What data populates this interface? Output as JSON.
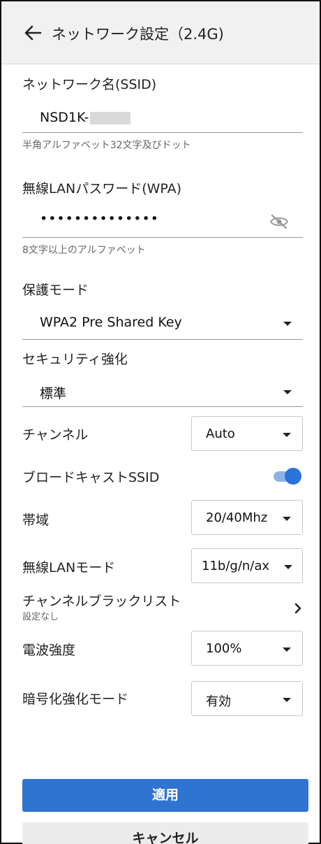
{
  "header": {
    "title": "ネットワーク設定（2.4G)",
    "back_icon": "arrow-left-icon"
  },
  "ssid": {
    "label": "ネットワーク名(SSID)",
    "value": "NSD1K-",
    "hint": "半角アルファベット32文字及びドット"
  },
  "password": {
    "label": "無線LANパスワード(WPA)",
    "value": "••••••••••••••",
    "hint": "8文字以上のアルファベット",
    "toggle_icon": "eye-off-icon"
  },
  "protection": {
    "label": "保護モード",
    "value": "WPA2 Pre Shared Key"
  },
  "security": {
    "label": "セキュリティ強化",
    "value": "標準"
  },
  "channel": {
    "label": "チャンネル",
    "value": "Auto"
  },
  "broadcast": {
    "label": "ブロードキャストSSID",
    "enabled": true
  },
  "bandwidth": {
    "label": "帯域",
    "value": "20/40Mhz"
  },
  "wireless_mode": {
    "label": "無線LANモード",
    "value": "11b/g/n/ax"
  },
  "blacklist": {
    "label": "チャンネルブラックリスト",
    "sub": "設定なし"
  },
  "signal": {
    "label": "電波強度",
    "value": "100%"
  },
  "encryption": {
    "label": "暗号化強化モード",
    "value": "有効"
  },
  "buttons": {
    "apply": "適用",
    "cancel": "キャンセル"
  },
  "colors": {
    "accent": "#2f74d0",
    "toggle_on": "#2a73d8",
    "header_bg": "#f1f1f1"
  }
}
